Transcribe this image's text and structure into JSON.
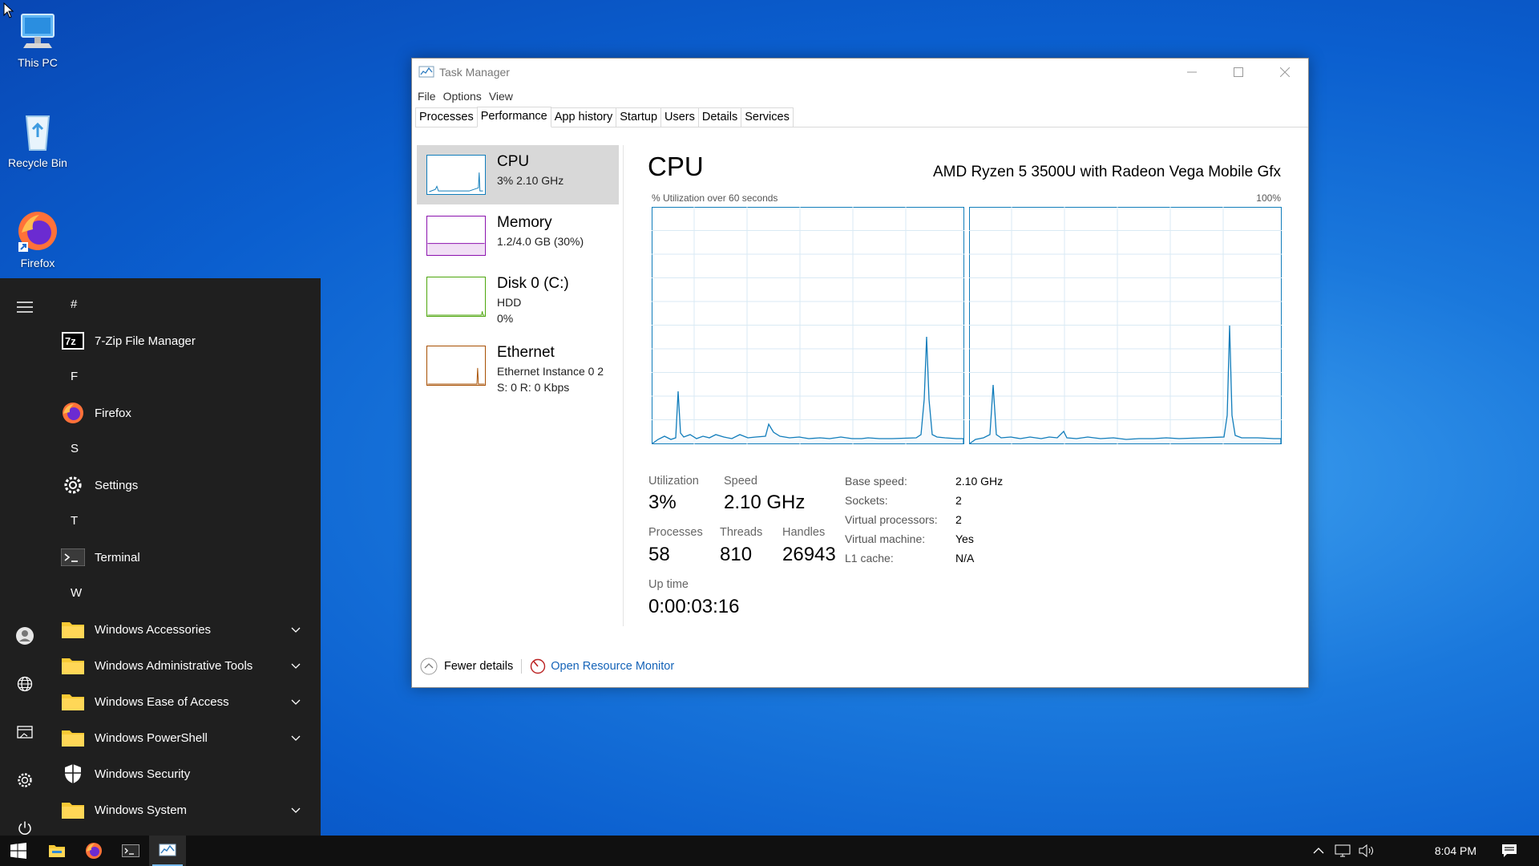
{
  "desktop": {
    "icons": [
      {
        "label": "This PC",
        "icon": "computer-icon"
      },
      {
        "label": "Recycle Bin",
        "icon": "recycle-bin-icon"
      },
      {
        "label": "Firefox",
        "icon": "firefox-icon"
      }
    ]
  },
  "start_menu": {
    "letters": [
      "#",
      "F",
      "S",
      "T",
      "W"
    ],
    "apps": [
      {
        "label": "7-Zip File Manager",
        "icon": "7zip-icon"
      },
      {
        "label": "Firefox",
        "icon": "firefox-icon"
      },
      {
        "label": "Settings",
        "icon": "gear-icon"
      },
      {
        "label": "Terminal",
        "icon": "terminal-icon"
      },
      {
        "label": "Windows Accessories",
        "icon": "folder-icon",
        "expandable": true
      },
      {
        "label": "Windows Administrative Tools",
        "icon": "folder-icon",
        "expandable": true
      },
      {
        "label": "Windows Ease of Access",
        "icon": "folder-icon",
        "expandable": true
      },
      {
        "label": "Windows PowerShell",
        "icon": "folder-icon",
        "expandable": true
      },
      {
        "label": "Windows Security",
        "icon": "shield-icon"
      },
      {
        "label": "Windows System",
        "icon": "folder-icon",
        "expandable": true
      }
    ]
  },
  "taskbar": {
    "clock": "8:04 PM"
  },
  "task_manager": {
    "title": "Task Manager",
    "menu": [
      "File",
      "Options",
      "View"
    ],
    "tabs": [
      "Processes",
      "Performance",
      "App history",
      "Startup",
      "Users",
      "Details",
      "Services"
    ],
    "active_tab": "Performance",
    "sidebar": [
      {
        "title": "CPU",
        "line1": "3% 2.10 GHz",
        "line2": "",
        "color": "#117dbb"
      },
      {
        "title": "Memory",
        "line1": "1.2/4.0 GB (30%)",
        "line2": "",
        "color": "#8b12ae"
      },
      {
        "title": "Disk 0 (C:)",
        "line1": "HDD",
        "line2": "0%",
        "color": "#4da60c"
      },
      {
        "title": "Ethernet",
        "line1": "Ethernet Instance 0 2",
        "line2": "S: 0 R: 0 Kbps",
        "color": "#a74f01"
      }
    ],
    "perf": {
      "title": "CPU",
      "cpu_name": "AMD Ryzen 5 3500U with Radeon Vega Mobile Gfx",
      "graph_caption": "% Utilization over 60 seconds",
      "graph_max": "100%",
      "stats": {
        "utilization_label": "Utilization",
        "utilization": "3%",
        "speed_label": "Speed",
        "speed": "2.10 GHz",
        "processes_label": "Processes",
        "processes": "58",
        "threads_label": "Threads",
        "threads": "810",
        "handles_label": "Handles",
        "handles": "26943",
        "uptime_label": "Up time",
        "uptime": "0:00:03:16"
      },
      "specs": [
        {
          "label": "Base speed:",
          "value": "2.10 GHz"
        },
        {
          "label": "Sockets:",
          "value": "2"
        },
        {
          "label": "Virtual processors:",
          "value": "2"
        },
        {
          "label": "Virtual machine:",
          "value": "Yes"
        },
        {
          "label": "L1 cache:",
          "value": "N/A"
        }
      ]
    },
    "footer": {
      "fewer_details": "Fewer details",
      "open_resource_monitor": "Open Resource Monitor"
    },
    "graph_line_color": "#117dbb",
    "graph_grid_color": "#d9eaf4"
  }
}
